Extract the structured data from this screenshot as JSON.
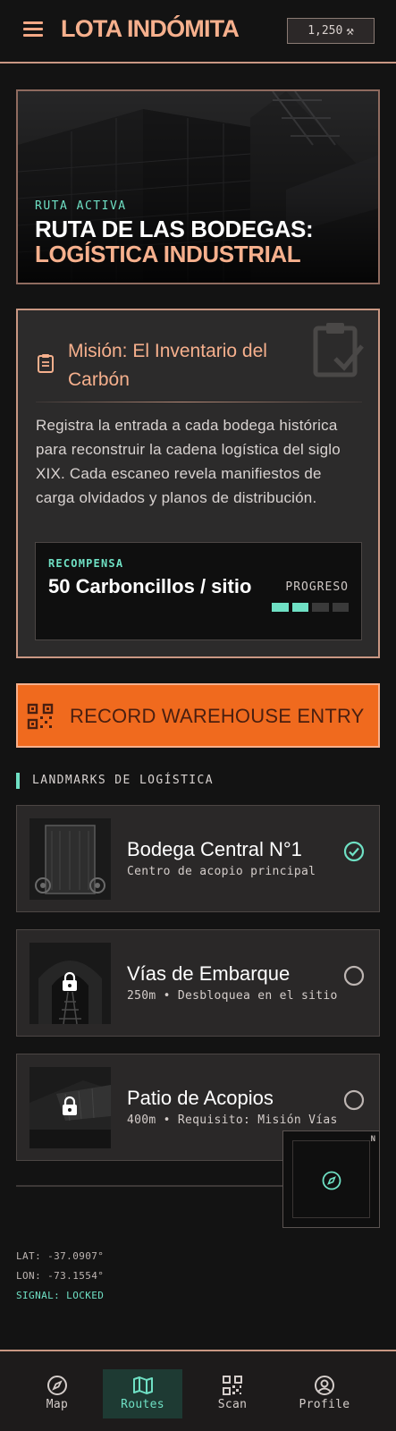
{
  "header": {
    "title": "LOTA INDÓMITA",
    "balance": "1,250",
    "balance_icon": "pickaxe-hammer-icon"
  },
  "hero": {
    "kicker": "RUTA ACTIVA",
    "title_line1": "RUTA DE LAS BODEGAS:",
    "title_line2": "LOGÍSTICA INDUSTRIAL"
  },
  "mission": {
    "title": "Misión: El Inventario del Carbón",
    "description": "Registra la entrada a cada bodega histórica para reconstruir la cadena logística del siglo XIX. Cada escaneo revela manifiestos de carga olvidados y planos de distribución.",
    "reward_label": "RECOMPENSA",
    "reward_value": "50 Carboncillos / sitio",
    "progress_label": "PROGRESO",
    "progress_done": 2,
    "progress_total": 4
  },
  "record_button": {
    "label": "RECORD WAREHOUSE ENTRY"
  },
  "landmarks": {
    "section_title": "LANDMARKS DE LOGÍSTICA",
    "items": [
      {
        "name": "Bodega Central N°1",
        "subtitle": "Centro de acopio principal",
        "status": "completed",
        "locked": false
      },
      {
        "name": "Vías de Embarque",
        "subtitle": "250m • Desbloquea en el sitio",
        "status": "pending",
        "locked": true
      },
      {
        "name": "Patio de Acopios",
        "subtitle": "400m • Requisito: Misión Vías",
        "status": "pending",
        "locked": true
      }
    ]
  },
  "location": {
    "lat": "LAT: -37.0907°",
    "lon": "LON: -73.1554°",
    "signal": "SIGNAL: LOCKED",
    "minimap_north": "N"
  },
  "nav": {
    "items": [
      {
        "label": "Map",
        "icon": "compass-icon",
        "active": false
      },
      {
        "label": "Routes",
        "icon": "map-icon",
        "active": true
      },
      {
        "label": "Scan",
        "icon": "qr-scan-icon",
        "active": false
      },
      {
        "label": "Profile",
        "icon": "profile-icon",
        "active": false
      }
    ]
  },
  "colors": {
    "accent_peach": "#f6b08d",
    "accent_teal": "#6fe0c4",
    "accent_orange": "#f06a1e",
    "background": "#131313"
  }
}
